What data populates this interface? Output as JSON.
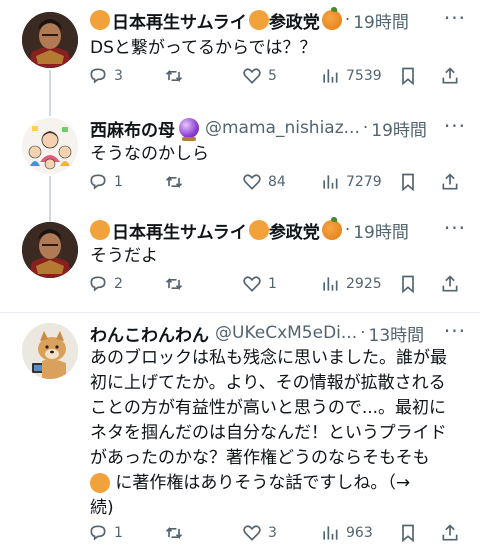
{
  "tweets": [
    {
      "name": "日本再生サムライ",
      "party": "参政党",
      "time": "19時間",
      "text": "DSと繋がってるからでは？？",
      "replies": "3",
      "likes": "5",
      "views": "7539"
    },
    {
      "name": "西麻布の母",
      "handle": "@mama_nishiaz...",
      "time": "19時間",
      "text": "そうなのかしら",
      "replies": "1",
      "likes": "84",
      "views": "7279"
    },
    {
      "name": "日本再生サムライ",
      "party": "参政党",
      "time": "19時間",
      "text": "そうだよ",
      "replies": "2",
      "likes": "1",
      "views": "2925"
    },
    {
      "name": "わんこわんわん",
      "handle": "@UKeCxM5eDi...",
      "time": "13時間",
      "lines": [
        "あのブロックは私も残念に思いました。誰が最",
        "初に上げてたか。より、その情報が拡散される",
        "ことの方が有益性が高いと思うので...。最初に",
        "ネタを掴んだのは自分なんだ！というプライド",
        "があったのかな？著作権どうのならそもそも",
        "に著作権はありそうな話ですしね。（→",
        "続)"
      ],
      "replies": "1",
      "likes": "3",
      "views": "963"
    }
  ],
  "separator": "·",
  "icons": [
    "reply-icon",
    "retweet-icon",
    "like-icon",
    "views-icon",
    "bookmark-icon",
    "share-icon"
  ],
  "colors": {
    "secondary_text": "#536471",
    "thread_line": "#cfd9de"
  }
}
